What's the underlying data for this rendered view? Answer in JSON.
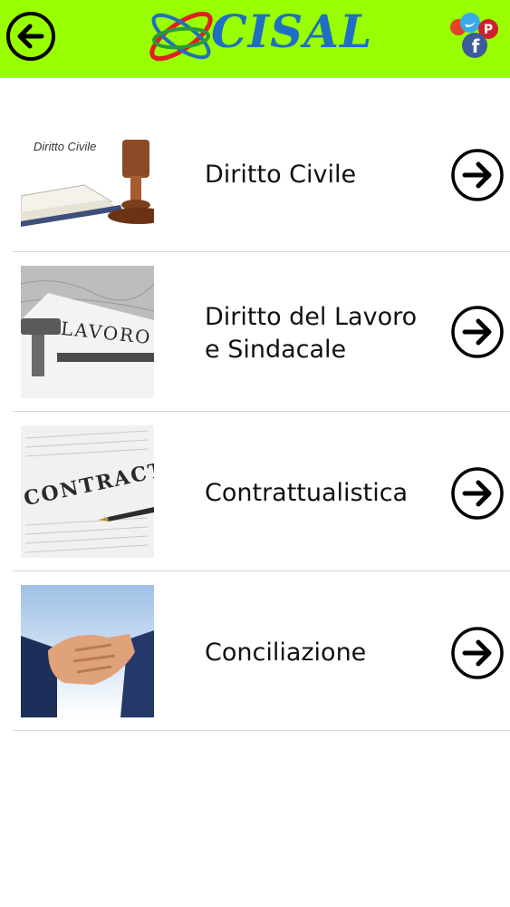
{
  "header": {
    "logo_text": "CISAL",
    "background_color": "#99ff00",
    "back_icon": "arrow-left-circle-icon",
    "social_icon": "social-media-cluster-icon"
  },
  "menu": [
    {
      "label_line1": "Diritto Civile",
      "label_line2": "",
      "thumb_caption": "Diritto Civile",
      "arrow_icon": "arrow-right-circle-icon"
    },
    {
      "label_line1": "Diritto del Lavoro",
      "label_line2": "e Sindacale",
      "thumb_caption": "LAVORO",
      "arrow_icon": "arrow-right-circle-icon"
    },
    {
      "label_line1": "Contrattualistica",
      "label_line2": "",
      "thumb_caption": "CONTRACT",
      "arrow_icon": "arrow-right-circle-icon"
    },
    {
      "label_line1": "Conciliazione",
      "label_line2": "",
      "thumb_caption": "",
      "arrow_icon": "arrow-right-circle-icon"
    }
  ]
}
